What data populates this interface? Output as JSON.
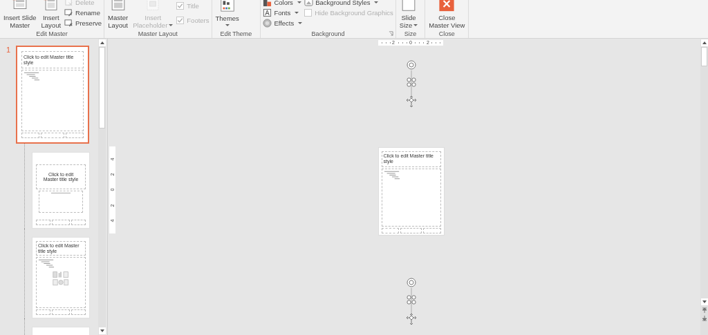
{
  "ribbon": {
    "groups": [
      {
        "label": "Edit Master",
        "items": [
          {
            "kind": "large",
            "lines": [
              "Insert Slide",
              "Master"
            ],
            "disabled": false,
            "dropdown": false
          },
          {
            "kind": "large",
            "lines": [
              "Insert",
              "Layout"
            ],
            "disabled": false,
            "dropdown": false
          },
          {
            "kind": "stack",
            "items": [
              {
                "kind": "button",
                "label": "Delete",
                "disabled": true,
                "dropdown": false
              },
              {
                "kind": "button",
                "label": "Rename",
                "disabled": false,
                "dropdown": false
              },
              {
                "kind": "button",
                "label": "Preserve",
                "disabled": false,
                "dropdown": false
              }
            ]
          }
        ]
      },
      {
        "label": "Master Layout",
        "items": [
          {
            "kind": "large",
            "lines": [
              "Master",
              "Layout"
            ],
            "disabled": false,
            "dropdown": false
          },
          {
            "kind": "large",
            "lines": [
              "Insert",
              "Placeholder"
            ],
            "disabled": true,
            "dropdown": true
          },
          {
            "kind": "stack",
            "items": [
              {
                "kind": "check",
                "label": "Title",
                "checked": true,
                "disabled": true
              },
              {
                "kind": "check",
                "label": "Footers",
                "checked": true,
                "disabled": true
              }
            ]
          }
        ]
      },
      {
        "label": "Edit Theme",
        "items": [
          {
            "kind": "large",
            "lines": [
              "Themes"
            ],
            "disabled": false,
            "dropdown": true
          }
        ]
      },
      {
        "label": "Background",
        "launcher": true,
        "items": [
          {
            "kind": "stack",
            "items": [
              {
                "kind": "button",
                "label": "Colors",
                "disabled": false,
                "dropdown": true
              },
              {
                "kind": "button",
                "label": "Fonts",
                "disabled": false,
                "dropdown": true
              },
              {
                "kind": "button",
                "label": "Effects",
                "disabled": false,
                "dropdown": true
              }
            ]
          },
          {
            "kind": "stack",
            "items": [
              {
                "kind": "button",
                "label": "Background Styles",
                "disabled": false,
                "dropdown": true
              },
              {
                "kind": "check",
                "label": "Hide Background Graphics",
                "checked": false,
                "disabled": true
              }
            ]
          }
        ]
      },
      {
        "label": "Size",
        "items": [
          {
            "kind": "large",
            "lines": [
              "Slide",
              "Size"
            ],
            "disabled": false,
            "dropdown": true
          }
        ]
      },
      {
        "label": "Close",
        "items": [
          {
            "kind": "large",
            "lines": [
              "Close",
              "Master View"
            ],
            "disabled": false,
            "dropdown": false
          }
        ]
      }
    ]
  },
  "thumbnails": [
    {
      "kind": "master",
      "number": "1",
      "selected": true,
      "title": "Click to edit Master title style"
    },
    {
      "kind": "title",
      "selected": false,
      "title": "Click to edit Master title style"
    },
    {
      "kind": "content",
      "selected": false,
      "title": "Click to edit Master title style"
    },
    {
      "kind": "blank",
      "selected": false
    }
  ],
  "horizontal_ruler": {
    "labels": [
      "2",
      "0",
      "2"
    ]
  },
  "vertical_ruler": {
    "labels": [
      "4",
      "2",
      "0",
      "2",
      "4"
    ]
  },
  "slide": {
    "title": "Click to edit Master title style"
  }
}
